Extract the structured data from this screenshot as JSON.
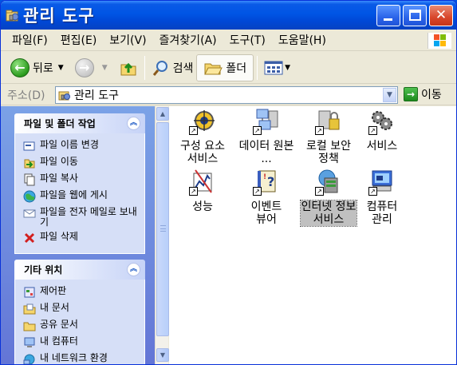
{
  "window": {
    "title": "관리 도구",
    "icon": "admin-tools-icon"
  },
  "menubar": {
    "items": [
      "파일(F)",
      "편집(E)",
      "보기(V)",
      "즐겨찾기(A)",
      "도구(T)",
      "도움말(H)"
    ]
  },
  "toolbar": {
    "back_label": "뒤로",
    "search_label": "검색",
    "folders_label": "폴더"
  },
  "address": {
    "label": "주소(D)",
    "value": "관리 도구",
    "go_label": "이동"
  },
  "taskpane": {
    "file_tasks": {
      "title": "파일 및 폴더 작업",
      "items": [
        {
          "label": "파일 이름 변경",
          "icon": "rename-icon"
        },
        {
          "label": "파일 이동",
          "icon": "move-icon"
        },
        {
          "label": "파일 복사",
          "icon": "copy-icon"
        },
        {
          "label": "파일을 웹에 게시",
          "icon": "web-publish-icon"
        },
        {
          "label": "파일을 전자 메일로 보내기",
          "icon": "email-icon"
        },
        {
          "label": "파일 삭제",
          "icon": "delete-icon"
        }
      ]
    },
    "other_places": {
      "title": "기타 위치",
      "items": [
        {
          "label": "제어판",
          "icon": "control-panel-icon"
        },
        {
          "label": "내 문서",
          "icon": "my-documents-icon"
        },
        {
          "label": "공유 문서",
          "icon": "shared-documents-icon"
        },
        {
          "label": "내 컴퓨터",
          "icon": "my-computer-icon"
        },
        {
          "label": "내 네트워크 환경",
          "icon": "my-network-icon"
        }
      ]
    }
  },
  "content": {
    "items": [
      {
        "label": "구성 요소 서비스",
        "icon": "component-services-icon",
        "selected": false
      },
      {
        "label": "데이터 원본 ...",
        "icon": "data-sources-icon",
        "selected": false
      },
      {
        "label": "로컬 보안 정책",
        "icon": "local-security-policy-icon",
        "selected": false
      },
      {
        "label": "서비스",
        "icon": "services-icon",
        "selected": false
      },
      {
        "label": "성능",
        "icon": "performance-icon",
        "selected": false
      },
      {
        "label": "이벤트 뷰어",
        "icon": "event-viewer-icon",
        "selected": false
      },
      {
        "label": "인터넷 정보 서비스",
        "icon": "iis-icon",
        "selected": true
      },
      {
        "label": "컴퓨터 관리",
        "icon": "computer-management-icon",
        "selected": false
      }
    ]
  },
  "colors": {
    "titlebar": "#0055e5",
    "taskpane_bg": "#7ba2e7",
    "panel_body": "#d6dff7",
    "selection": "#c0c0c0"
  }
}
